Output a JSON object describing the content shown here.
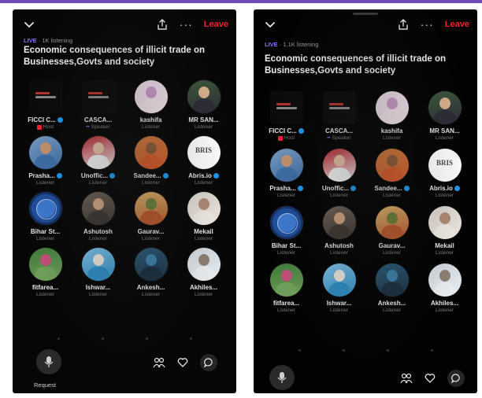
{
  "space_left": {
    "status_live": "LIVE",
    "status_rest": " · 1K listening",
    "title": "Economic consequences of illicit trade on Businesses,Govts and society",
    "leave_label": "Leave",
    "request_label": "Request"
  },
  "space_right": {
    "status_live": "LIVE",
    "status_rest": " · 1.1K listening",
    "title": "Economic consequences of illicit trade on Businesses,Govts and society",
    "leave_label": "Leave"
  },
  "participants": [
    {
      "name": "FICCI C...",
      "role": "Host",
      "verified": true,
      "avatar": "logo"
    },
    {
      "name": "CASCA...",
      "role": "Speaker",
      "verified": false,
      "avatar": "logo"
    },
    {
      "name": "kashifa",
      "role": "Listener",
      "verified": false,
      "avatar": "photo",
      "colors": [
        "#e8d6e4",
        "#c79ac4",
        "#f1e3ea"
      ]
    },
    {
      "name": "MR SAN...",
      "role": "Listener",
      "verified": false,
      "avatar": "photo",
      "colors": [
        "#3d5a3a",
        "#d9b08c",
        "#2c2c38"
      ]
    },
    {
      "name": "Prasha...",
      "role": "Listener",
      "verified": true,
      "avatar": "photo",
      "colors": [
        "#7a9fc4",
        "#c9946d",
        "#3e6ea8"
      ]
    },
    {
      "name": "Unoffic...",
      "role": "Listener",
      "verified": true,
      "avatar": "photo",
      "colors": [
        "#b3242b",
        "#e3bfa3",
        "#f2f2f2"
      ]
    },
    {
      "name": "Sandee...",
      "role": "Listener",
      "verified": true,
      "avatar": "photo",
      "colors": [
        "#c97a3c",
        "#8a5a3a",
        "#d45a2a"
      ]
    },
    {
      "name": "Abris.io",
      "role": "Listener",
      "verified": true,
      "avatar": "brand",
      "brand_text": "BRIS"
    },
    {
      "name": "Bihar St...",
      "role": "Listener",
      "verified": false,
      "avatar": "globe"
    },
    {
      "name": "Ashutosh",
      "role": "Listener",
      "verified": false,
      "avatar": "photo",
      "colors": [
        "#6e6258",
        "#cfa27d",
        "#3e3731"
      ]
    },
    {
      "name": "Gaurav...",
      "role": "Listener",
      "verified": false,
      "avatar": "photo",
      "colors": [
        "#d9b46c",
        "#6a7d3a",
        "#b5562c"
      ]
    },
    {
      "name": "Mekail",
      "role": "Listener",
      "verified": false,
      "avatar": "photo",
      "colors": [
        "#d8d3cc",
        "#b08a74",
        "#efe9e3"
      ]
    },
    {
      "name": "fitfarea...",
      "role": "Listener",
      "verified": false,
      "avatar": "photo",
      "colors": [
        "#3f7a3a",
        "#c2507a",
        "#6fa05a"
      ]
    },
    {
      "name": "Ishwar...",
      "role": "Listener",
      "verified": false,
      "avatar": "photo",
      "colors": [
        "#7fc2e6",
        "#e6e2d8",
        "#2f8ac0"
      ]
    },
    {
      "name": "Ankesh...",
      "role": "Listener",
      "verified": false,
      "avatar": "photo",
      "colors": [
        "#2b5c7a",
        "#3a7fa6",
        "#1a2f40"
      ]
    },
    {
      "name": "Akhiles...",
      "role": "Listener",
      "verified": false,
      "avatar": "photo",
      "colors": [
        "#cfd6dc",
        "#8d7f72",
        "#e8ecef"
      ]
    }
  ],
  "icons": {
    "collapse": "chevron-down-icon",
    "share": "share-icon",
    "more": "more-icon",
    "people": "people-icon",
    "reaction": "heart-icon",
    "chat": "chat-icon",
    "mic": "mic-icon"
  },
  "colors": {
    "leave": "#f4212e",
    "live": "#8a74ff",
    "verified": "#1d9bf0",
    "bar": "#6b4bb3"
  }
}
